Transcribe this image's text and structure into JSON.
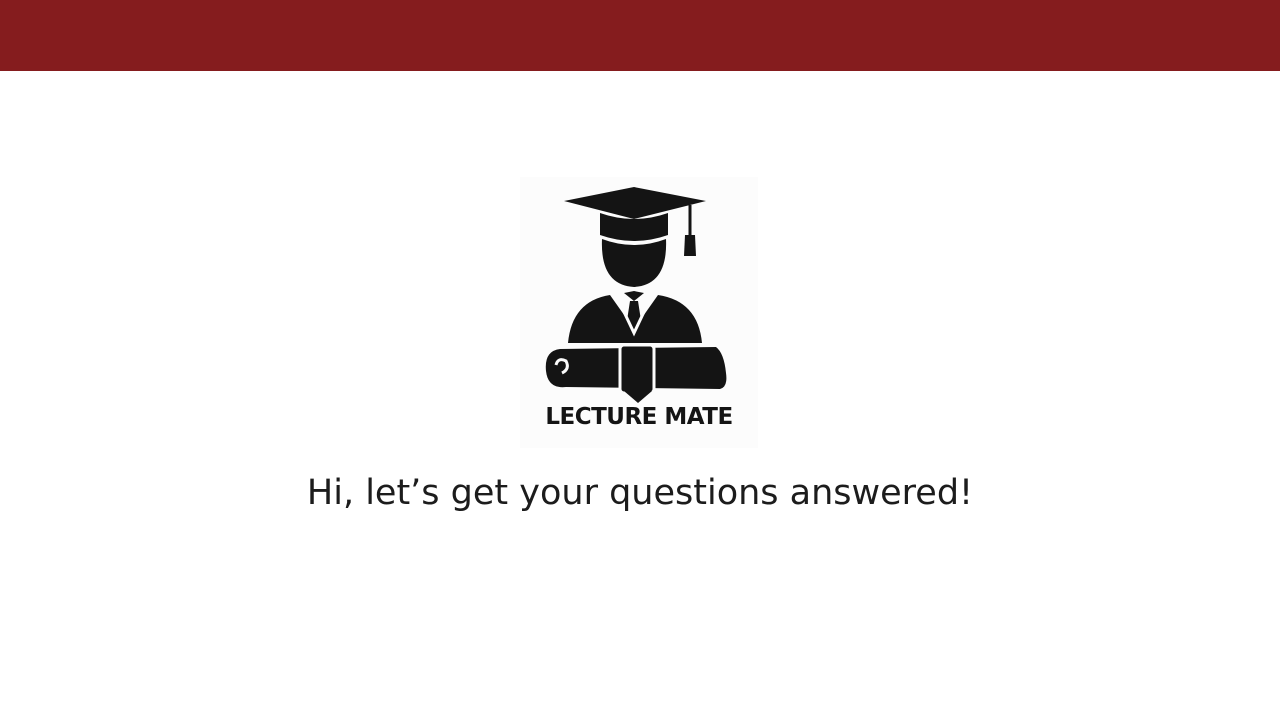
{
  "header": {
    "bar_color": "#851c1e"
  },
  "logo": {
    "icon": "graduate-icon",
    "text": "LECTURE MATE"
  },
  "main": {
    "greeting": "Hi, let’s get your questions answered!"
  }
}
